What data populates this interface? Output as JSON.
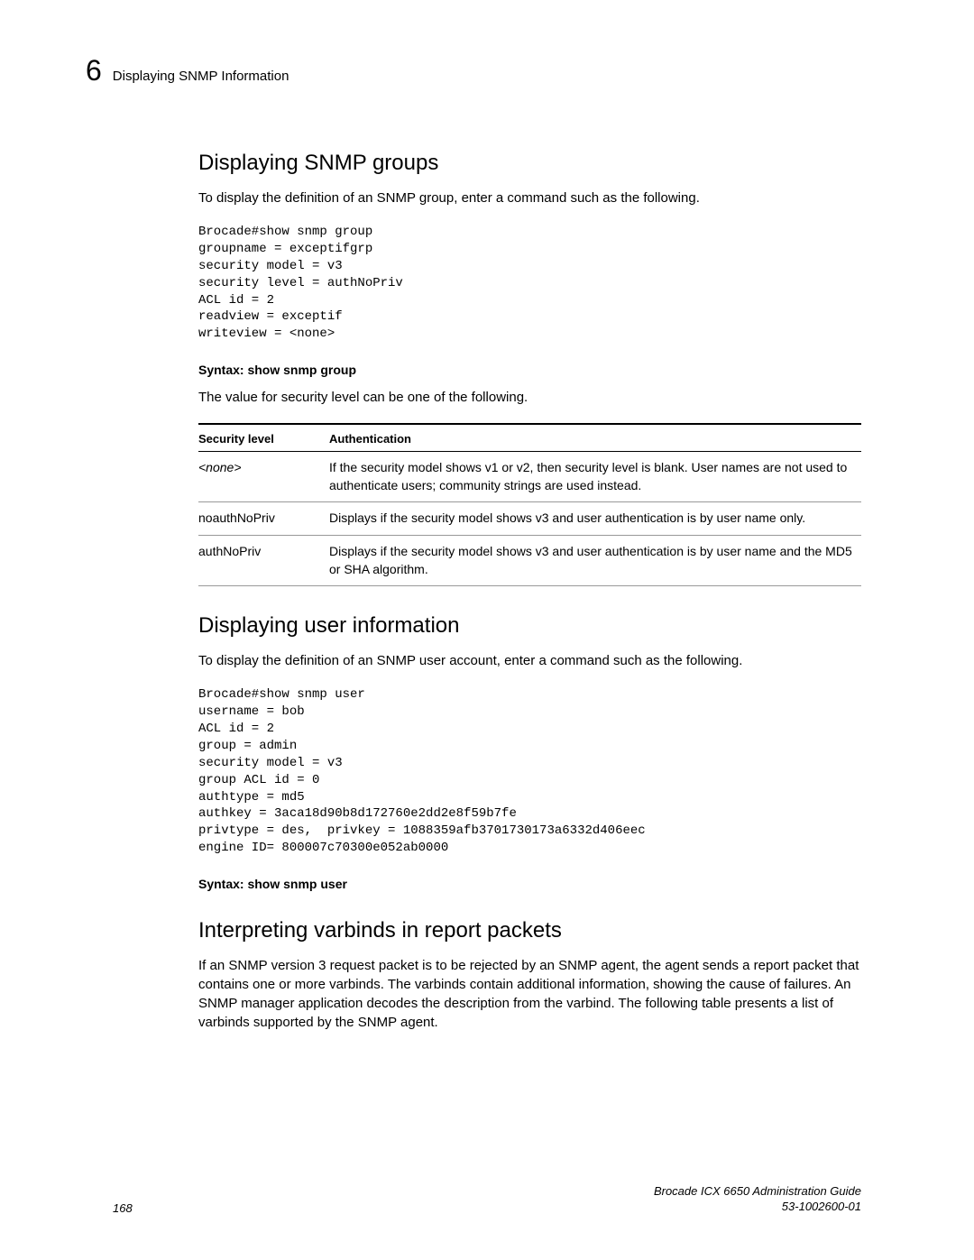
{
  "header": {
    "chapter_number": "6",
    "chapter_title": "Displaying SNMP Information"
  },
  "sections": {
    "snmp_groups": {
      "heading": "Displaying SNMP groups",
      "intro": "To display the definition of an SNMP group, enter a command such as the following.",
      "code": "Brocade#show snmp group\ngroupname = exceptifgrp\nsecurity model = v3\nsecurity level = authNoPriv\nACL id = 2\nreadview = exceptif\nwriteview = <none>",
      "syntax": "Syntax:  show snmp group",
      "note": "The value for security level can be one of the following.",
      "table": {
        "header_security": "Security level",
        "header_auth": "Authentication",
        "rows": [
          {
            "security": "<none>",
            "security_italic": true,
            "auth": "If the security model shows v1 or v2, then security level is blank. User names are not used to authenticate users; community strings are used instead."
          },
          {
            "security": "noauthNoPriv",
            "security_italic": false,
            "auth": "Displays if the security model shows v3 and user authentication is by user name only."
          },
          {
            "security": "authNoPriv",
            "security_italic": false,
            "auth": "Displays if the security model shows v3 and user authentication is by user name and the MD5 or SHA algorithm."
          }
        ]
      }
    },
    "user_info": {
      "heading": "Displaying user information",
      "intro": "To display the definition of an SNMP user account, enter a command such as the following.",
      "code": "Brocade#show snmp user\nusername = bob\nACL id = 2\ngroup = admin\nsecurity model = v3\ngroup ACL id = 0\nauthtype = md5\nauthkey = 3aca18d90b8d172760e2dd2e8f59b7fe\nprivtype = des,  privkey = 1088359afb3701730173a6332d406eec\nengine ID= 800007c70300e052ab0000",
      "syntax": "Syntax:  show snmp user"
    },
    "varbinds": {
      "heading": "Interpreting varbinds in report packets",
      "intro": "If an SNMP version 3 request packet is to be rejected by an SNMP agent, the agent sends a report packet that contains one or more varbinds. The varbinds contain additional information, showing the cause of failures. An SNMP manager application decodes the description from the varbind. The following table presents a list of varbinds supported by the SNMP agent."
    }
  },
  "footer": {
    "page_number": "168",
    "guide_title": "Brocade ICX 6650 Administration Guide",
    "doc_number": "53-1002600-01"
  }
}
